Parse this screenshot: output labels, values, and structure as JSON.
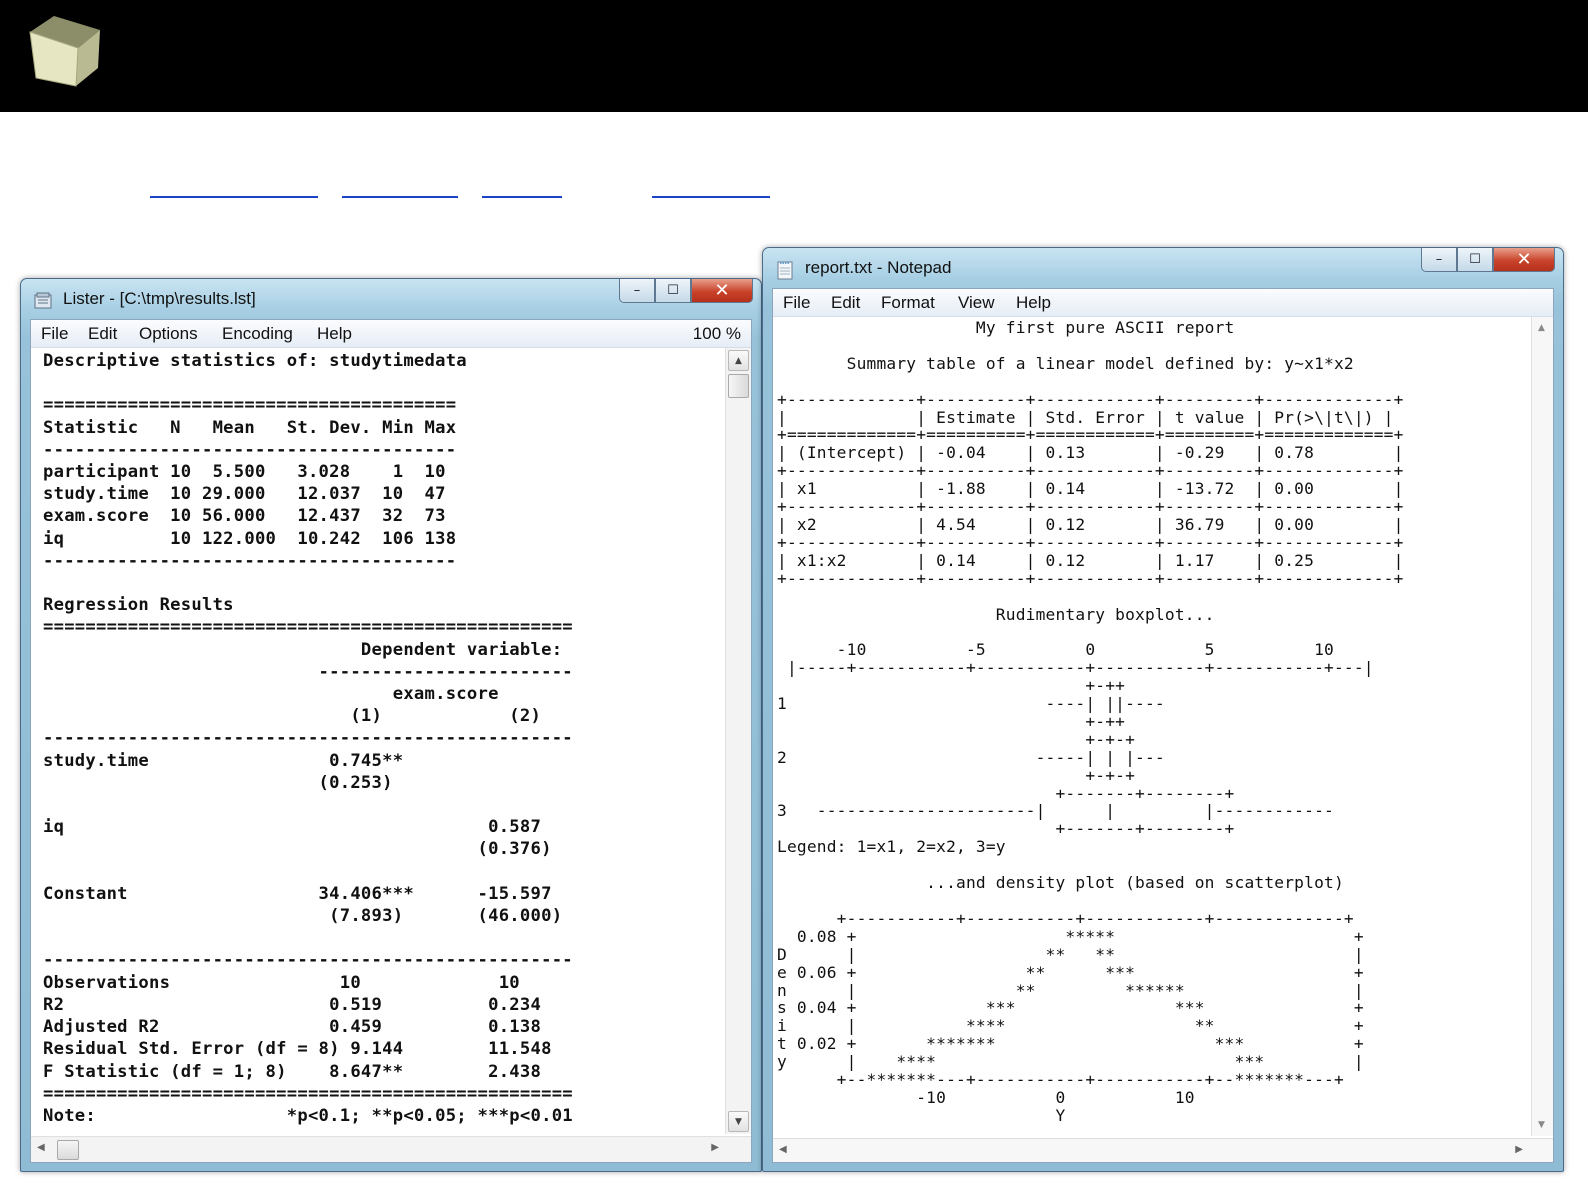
{
  "links": [
    "",
    "",
    "",
    ""
  ],
  "lister": {
    "title": "Lister - [C:\\tmp\\results.lst]",
    "controls": {
      "minimize": "–",
      "maximize": "☐",
      "close": "✕"
    },
    "menu": [
      "File",
      "Edit",
      "Options",
      "Encoding",
      "Help"
    ],
    "zoom": "100 %",
    "text": "Descriptive statistics of: studytimedata\n\n=======================================\nStatistic   N   Mean   St. Dev. Min Max\n---------------------------------------\nparticipant 10  5.500   3.028    1  10\nstudy.time  10 29.000   12.037  10  47\nexam.score  10 56.000   12.437  32  73\niq          10 122.000  10.242  106 138\n---------------------------------------\n\nRegression Results\n==================================================\n                              Dependent variable:\n                          ------------------------\n                                 exam.score\n                             (1)            (2)\n--------------------------------------------------\nstudy.time                 0.745**\n                          (0.253)\n\niq                                        0.587\n                                         (0.376)\n\nConstant                  34.406***      -15.597\n                           (7.893)       (46.000)\n\n--------------------------------------------------\nObservations                10             10\nR2                         0.519          0.234\nAdjusted R2                0.459          0.138\nResidual Std. Error (df = 8) 9.144        11.548\nF Statistic (df = 1; 8)    8.647**        2.438\n==================================================\nNote:                  *p<0.1; **p<0.05; ***p<0.01"
  },
  "notepad": {
    "title": "report.txt - Notepad",
    "controls": {
      "minimize": "–",
      "maximize": "☐",
      "close": "✕"
    },
    "menu": [
      "File",
      "Edit",
      "Format",
      "View",
      "Help"
    ],
    "text": "                    My first pure ASCII report\n\n       Summary table of a linear model defined by: y~x1*x2\n\n+-------------+----------+------------+---------+-------------+\n|             | Estimate | Std. Error | t value | Pr(>\\|t\\|) |\n+=============+==========+============+=========+=============+\n| (Intercept) | -0.04    | 0.13       | -0.29   | 0.78        |\n+-------------+----------+------------+---------+-------------+\n| x1          | -1.88    | 0.14       | -13.72  | 0.00        |\n+-------------+----------+------------+---------+-------------+\n| x2          | 4.54     | 0.12       | 36.79   | 0.00        |\n+-------------+----------+------------+---------+-------------+\n| x1:x2       | 0.14     | 0.12       | 1.17    | 0.25        |\n+-------------+----------+------------+---------+-------------+\n\n                      Rudimentary boxplot...\n\n      -10          -5          0           5          10\n |-----+-----------+-----------+-----------+-----------+---|\n                               +-++\n1                          ----| ||----\n                               +-++\n                               +-+-+\n2                         -----| | |---\n                               +-+-+\n                            +-------+--------+\n3   ----------------------|      |         |------------\n                            +-------+--------+\nLegend: 1=x1, 2=x2, 3=y\n\n               ...and density plot (based on scatterplot)\n\n      +-----------+-----------+------------+-------------+\n  0.08 +                     *****                        +\nD      |                   **   **                        |\ne 0.06 +                 **      ***                      +\nn      |                **         ******                 |\ns 0.04 +             ***                ***               +\ni      |           ****                   **              +\nt 0.02 +       *******                      ***           +\ny      |    ****                              ***         |\n      +--*******---+-----------+-----------+--*******---+\n              -10           0           10\n                            Y"
  }
}
